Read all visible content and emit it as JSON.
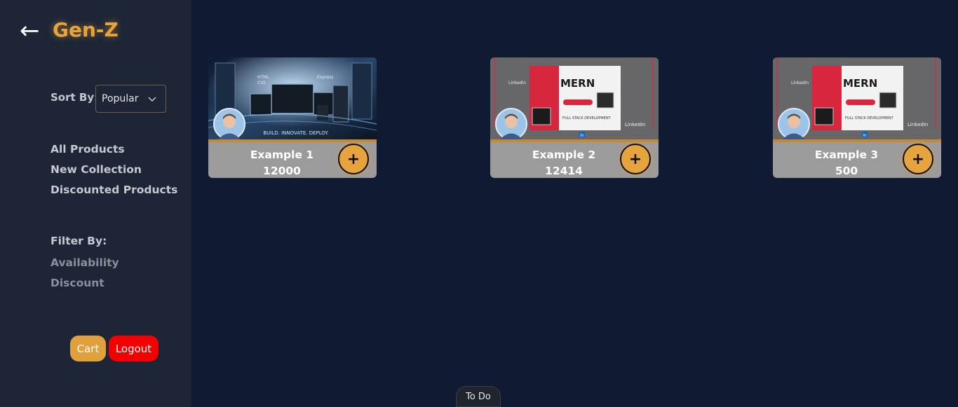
{
  "sidebar": {
    "back_arrow": "←",
    "brand": "Gen-Z",
    "sort_label": "Sort By:",
    "sort_value": "Popular",
    "nav_items": [
      "All Products",
      "New Collection",
      "Discounted Products"
    ],
    "filter_title": "Filter By:",
    "filter_items": [
      "Availability",
      "Discount"
    ],
    "cart_label": "Cart",
    "logout_label": "Logout"
  },
  "products": [
    {
      "name": "Example 1",
      "price": "12000",
      "add_label": "+"
    },
    {
      "name": "Example 2",
      "price": "12414",
      "add_label": "+"
    },
    {
      "name": "Example 3",
      "price": "500",
      "add_label": "+"
    }
  ],
  "thumbnail_text": {
    "code_tags": [
      "HTML",
      "CSS",
      "Express"
    ],
    "tagline": "BUILD. INNOVATE. DEPLOY.",
    "mern": "MERN",
    "mern_sub": "FULL STACK DEVELOPMENT",
    "linkedin": "LinkedIn",
    "linkedin_small": "Linkedin",
    "linkedin_badge": "in"
  },
  "footer": {
    "todo_label": "To Do"
  },
  "colors": {
    "page_bg": "#111a33",
    "sidebar_bg": "#1d2537",
    "brand": "#e8a33b",
    "cart": "#e0a13d",
    "logout": "#f50000",
    "card_body": "#9c9b9b",
    "add_button": "#e6a33e"
  }
}
